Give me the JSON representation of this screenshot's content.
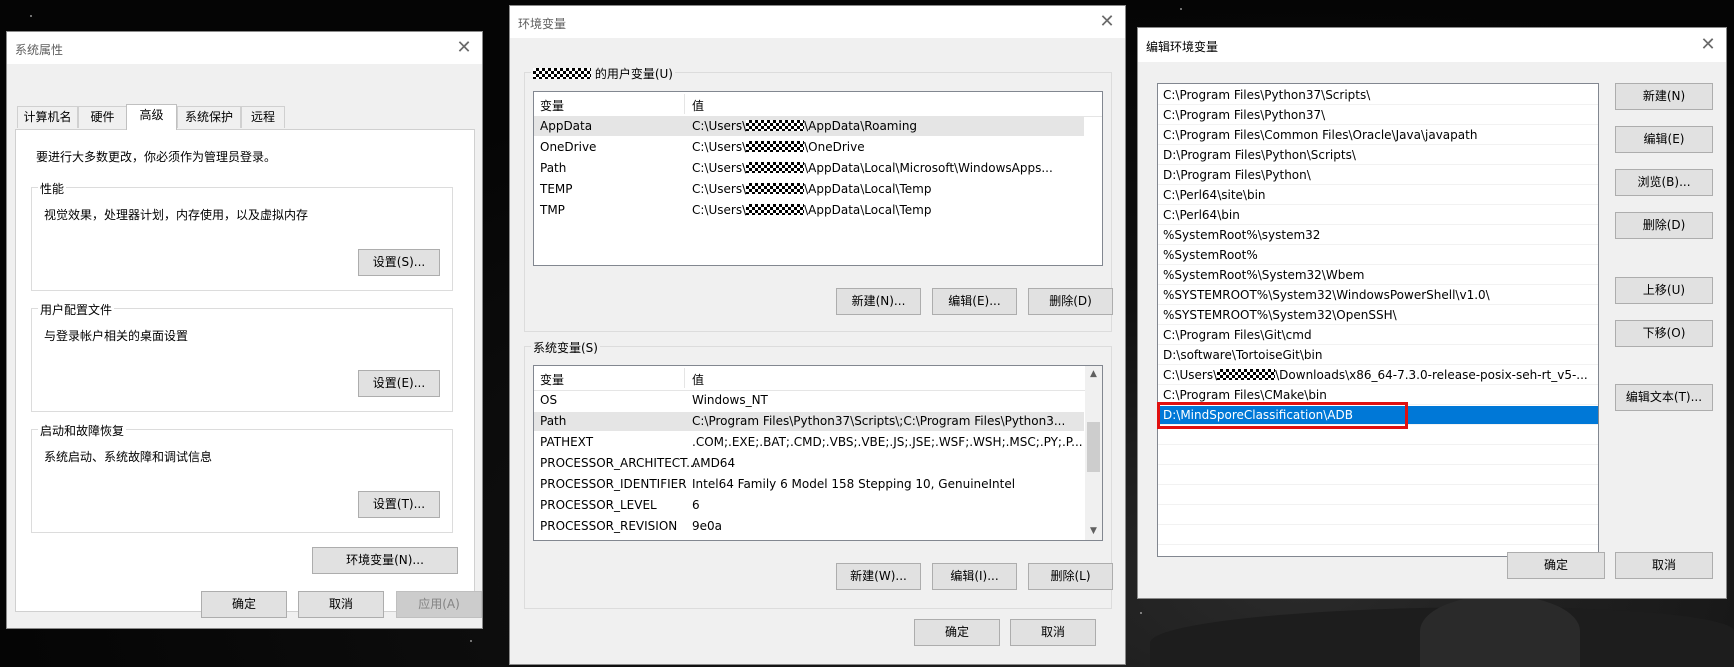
{
  "sysprops": {
    "title": "系统属性",
    "tabs": [
      "计算机名",
      "硬件",
      "高级",
      "系统保护",
      "远程"
    ],
    "admin_notice": "要进行大多数更改，你必须作为管理员登录。",
    "performance": {
      "label": "性能",
      "desc": "视觉效果，处理器计划，内存使用，以及虚拟内存",
      "button": "设置(S)..."
    },
    "profiles": {
      "label": "用户配置文件",
      "desc": "与登录帐户相关的桌面设置",
      "button": "设置(E)..."
    },
    "startup": {
      "label": "启动和故障恢复",
      "desc": "系统启动、系统故障和调试信息",
      "button": "设置(T)..."
    },
    "env_button": "环境变量(N)...",
    "ok": "确定",
    "cancel": "取消",
    "apply": "应用(A)"
  },
  "envvars": {
    "title": "环境变量",
    "user_group_label": " 的用户变量(U)",
    "col_var": "变量",
    "col_val": "值",
    "user_vars": [
      {
        "name": "AppData",
        "pre": "C:\\Users\\",
        "post": "\\AppData\\Roaming"
      },
      {
        "name": "OneDrive",
        "pre": "C:\\Users\\",
        "post": "\\OneDrive"
      },
      {
        "name": "Path",
        "pre": "C:\\Users\\",
        "post": "\\AppData\\Local\\Microsoft\\WindowsApps..."
      },
      {
        "name": "TEMP",
        "pre": "C:\\Users\\",
        "post": "\\AppData\\Local\\Temp"
      },
      {
        "name": "TMP",
        "pre": "C:\\Users\\",
        "post": "\\AppData\\Local\\Temp"
      }
    ],
    "user_new": "新建(N)...",
    "user_edit": "编辑(E)...",
    "user_delete": "删除(D)",
    "sys_group_label": "系统变量(S)",
    "sys_vars": [
      {
        "name": "OS",
        "value": "Windows_NT"
      },
      {
        "name": "Path",
        "value": "C:\\Program Files\\Python37\\Scripts\\;C:\\Program Files\\Python3..."
      },
      {
        "name": "PATHEXT",
        "value": ".COM;.EXE;.BAT;.CMD;.VBS;.VBE;.JS;.JSE;.WSF;.WSH;.MSC;.PY;.P..."
      },
      {
        "name": "PROCESSOR_ARCHITECT...",
        "value": "AMD64"
      },
      {
        "name": "PROCESSOR_IDENTIFIER",
        "value": "Intel64 Family 6 Model 158 Stepping 10, GenuineIntel"
      },
      {
        "name": "PROCESSOR_LEVEL",
        "value": "6"
      },
      {
        "name": "PROCESSOR_REVISION",
        "value": "9e0a"
      }
    ],
    "sys_new": "新建(W)...",
    "sys_edit": "编辑(I)...",
    "sys_delete": "删除(L)",
    "ok": "确定",
    "cancel": "取消"
  },
  "editenv": {
    "title": "编辑环境变量",
    "paths": [
      "C:\\Program Files\\Python37\\Scripts\\",
      "C:\\Program Files\\Python37\\",
      "C:\\Program Files\\Common Files\\Oracle\\Java\\javapath",
      "D:\\Program Files\\Python\\Scripts\\",
      "D:\\Program Files\\Python\\",
      "C:\\Perl64\\site\\bin",
      "C:\\Perl64\\bin",
      "%SystemRoot%\\system32",
      "%SystemRoot%",
      "%SystemRoot%\\System32\\Wbem",
      "%SYSTEMROOT%\\System32\\WindowsPowerShell\\v1.0\\",
      "%SYSTEMROOT%\\System32\\OpenSSH\\",
      "C:\\Program Files\\Git\\cmd",
      "D:\\software\\TortoiseGit\\bin",
      "C:\\Program Files\\CMake\\bin",
      "D:\\MindSporeClassification\\ADB"
    ],
    "masked_path_pre": "C:\\Users\\",
    "masked_path_post": "\\Downloads\\x86_64-7.3.0-release-posix-seh-rt_v5-...",
    "buttons": {
      "new": "新建(N)",
      "edit": "编辑(E)",
      "browse": "浏览(B)...",
      "delete": "删除(D)",
      "up": "上移(U)",
      "down": "下移(O)",
      "edit_text": "编辑文本(T)..."
    },
    "ok": "确定",
    "cancel": "取消",
    "highlight_color": "#e01010",
    "selection_color": "#0078d7"
  }
}
